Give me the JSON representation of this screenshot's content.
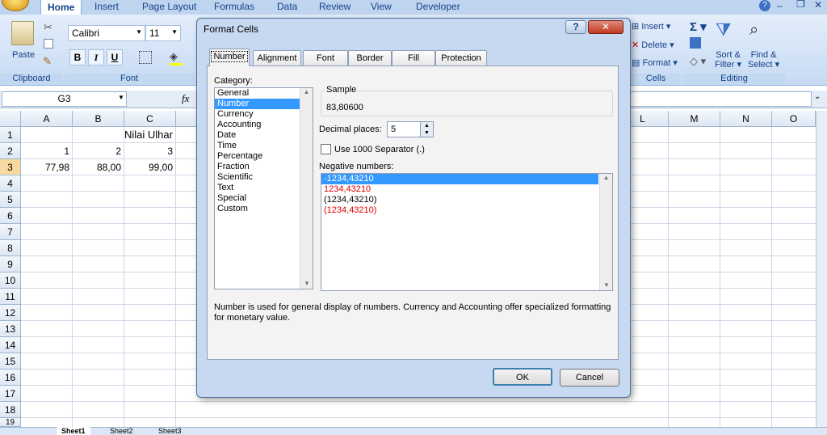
{
  "ribbon": {
    "tabs": [
      "Home",
      "Insert",
      "Page Layout",
      "Formulas",
      "Data",
      "Review",
      "View",
      "Developer"
    ],
    "paste_label": "Paste",
    "font_name": "Calibri",
    "font_size": "11",
    "bold": "B",
    "italic": "I",
    "underline": "U",
    "groups": {
      "clipboard": "Clipboard",
      "font": "Font",
      "cells": "Cells",
      "editing": "Editing"
    },
    "insert_label": "Insert",
    "delete_label": "Delete",
    "format_label": "Format",
    "sort_label": "Sort &",
    "filter_label": "Filter",
    "find_label": "Find &",
    "select_label": "Select"
  },
  "formula_bar": {
    "name_box": "G3",
    "fx": "fx"
  },
  "grid": {
    "columns": [
      "A",
      "B",
      "C",
      "L",
      "M",
      "N",
      "O"
    ],
    "rows": [
      "1",
      "2",
      "3",
      "4",
      "5",
      "6",
      "7",
      "8",
      "9",
      "10",
      "11",
      "12",
      "13",
      "14",
      "15",
      "16",
      "17",
      "18",
      "19"
    ],
    "title_cell": "Nilai Ulhar",
    "row2": [
      "1",
      "2",
      "3"
    ],
    "row3": [
      "77,98",
      "88,00",
      "99,00"
    ]
  },
  "sheets": [
    "Sheet1",
    "Sheet2",
    "Sheet3"
  ],
  "dialog": {
    "title": "Format Cells",
    "help": "?",
    "close": "✕",
    "tabs": [
      "Number",
      "Alignment",
      "Font",
      "Border",
      "Fill",
      "Protection"
    ],
    "category_label": "Category:",
    "categories": [
      "General",
      "Number",
      "Currency",
      "Accounting",
      "Date",
      "Time",
      "Percentage",
      "Fraction",
      "Scientific",
      "Text",
      "Special",
      "Custom"
    ],
    "sample_label": "Sample",
    "sample_value": "83,80600",
    "decimal_label": "Decimal places:",
    "decimal_value": "5",
    "separator_label": "Use 1000 Separator (.)",
    "negative_label": "Negative numbers:",
    "negatives": [
      "-1234,43210",
      "1234,43210",
      "(1234,43210)",
      "(1234,43210)"
    ],
    "description": "Number is used for general display of numbers.  Currency and Accounting offer specialized formatting for monetary value.",
    "ok": "OK",
    "cancel": "Cancel"
  },
  "colors": {
    "negative_red": "#e00000",
    "selection": "#3399ff"
  }
}
